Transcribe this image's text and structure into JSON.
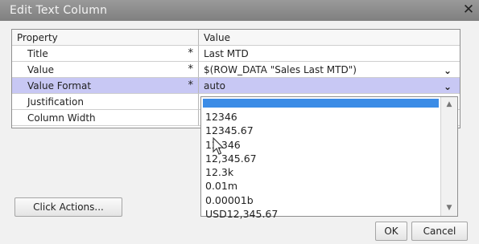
{
  "window": {
    "title": "Edit Text Column"
  },
  "grid": {
    "headers": {
      "property": "Property",
      "value": "Value"
    },
    "rows": [
      {
        "property": "Title",
        "value": "Last MTD",
        "required": "*"
      },
      {
        "property": "Value",
        "value": "$(ROW_DATA \"Sales Last MTD\")",
        "required": "*"
      },
      {
        "property": "Value Format",
        "value": "auto",
        "required": "*"
      },
      {
        "property": "Justification",
        "value": "",
        "required": ""
      },
      {
        "property": "Column Width",
        "value": "",
        "required": ""
      }
    ]
  },
  "dropdown": {
    "options": [
      "12346",
      "12345.67",
      "12,346",
      "12,345.67",
      "12.3k",
      "0.01m",
      "0.00001b",
      "USD12,345.67"
    ]
  },
  "buttons": {
    "click_actions": "Click Actions...",
    "ok": "OK",
    "cancel": "Cancel"
  },
  "colors": {
    "titlebar": "#8c8c8c",
    "selected_row": "#c8c8f4",
    "highlight": "#3c8ce6"
  }
}
